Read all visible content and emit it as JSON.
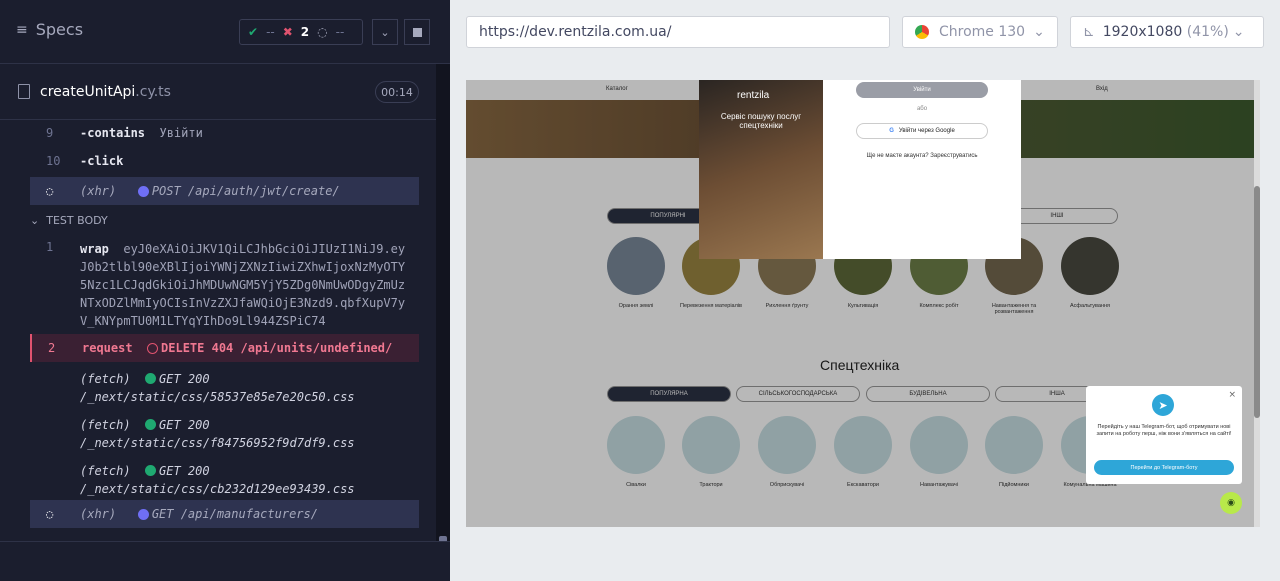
{
  "left": {
    "specs_label": "Specs",
    "passed": "--",
    "failed": "2",
    "pending": "--",
    "file_name": "createUnitApi",
    "file_ext": ".cy.ts",
    "timer": "00:14",
    "commands": [
      {
        "num": "9",
        "cmd": "-contains",
        "arg": "Увійти"
      },
      {
        "num": "10",
        "cmd": "-click",
        "arg": ""
      }
    ],
    "xhr1": {
      "label": "(xhr)",
      "text": "POST /api/auth/jwt/create/"
    },
    "section": "TEST BODY",
    "wrap": {
      "num": "1",
      "cmd": "wrap",
      "arg": "eyJ0eXAiOiJKV1QiLCJhbGciOiJIUzI1NiJ9.eyJ0b2tlbl90eXBlIjoiYWNjZXNzIiwiZXhwIjoxNzMyOTY5Nzc1LCJqdGkiOiJhMDUwNGM5YjY5ZDg0NmUwODgyZmUzNTxODZlMmIyOCIsInVzZXJfaWQiOjE3Nzd9.qbfXupV7yV_KNYpmTU0M1LTYqYIhDo9Ll944ZSPiC74"
    },
    "request": {
      "num": "2",
      "cmd": "request",
      "text": "DELETE 404 /api/units/undefined/"
    },
    "fetches": [
      {
        "label": "(fetch)",
        "method": "GET 200",
        "path": "/_next/static/css/58537e85e7e20c50.css"
      },
      {
        "label": "(fetch)",
        "method": "GET 200",
        "path": "/_next/static/css/f84756952f9d7df9.css"
      },
      {
        "label": "(fetch)",
        "method": "GET 200",
        "path": "/_next/static/css/cb232d129ee93439.css"
      }
    ],
    "xhr2": {
      "label": "(xhr)",
      "text": "GET /api/manufacturers/"
    }
  },
  "right": {
    "url": "https://dev.rentzila.com.ua/",
    "browser": "Chrome 130",
    "viewport": "1920x1080",
    "zoom": "(41%)",
    "aut": {
      "catalog": "Каталог",
      "enter": "Вхід",
      "modal_logo": "rentzila",
      "modal_tagline": "Сервіс пошуку послуг спецтехніки",
      "login_btn": "Увійти",
      "or": "або",
      "google_btn": "Увійти через Google",
      "no_account": "Ще не маєте акаунта? Зареєструватись",
      "pills_top": [
        "ПОПУЛЯРНІ",
        "ІНШІ"
      ],
      "services": [
        "Орання землі",
        "Перевезення матеріалів",
        "Рихлення ґрунту",
        "Культивація",
        "Комплекс робіт",
        "Навантаження та розвантаження",
        "Асфальтування"
      ],
      "spec_title": "Спецтехніка",
      "pills_spec": [
        "ПОПУЛЯРНА",
        "СІЛЬСЬКОГОСПОДАРСЬКА",
        "БУДІВЕЛЬНА",
        "ІНША"
      ],
      "spec_items": [
        "Сівалки",
        "Трактори",
        "Обприскувачі",
        "Екскаватори",
        "Навантажувачі",
        "Підйомники",
        "Комунальна машина"
      ],
      "telegram_text": "Перейдіть у наш Telegram-бот, щоб отримувати нові запити на роботу перш, ніж вони з'являться на сайті!",
      "telegram_btn": "Перейти до Telegram-боту"
    }
  },
  "colors": {
    "pass": "#1fa971",
    "fail": "#e0536f",
    "xhr_dot": "#6f6ff5",
    "fetch_dot": "#1fa971"
  }
}
